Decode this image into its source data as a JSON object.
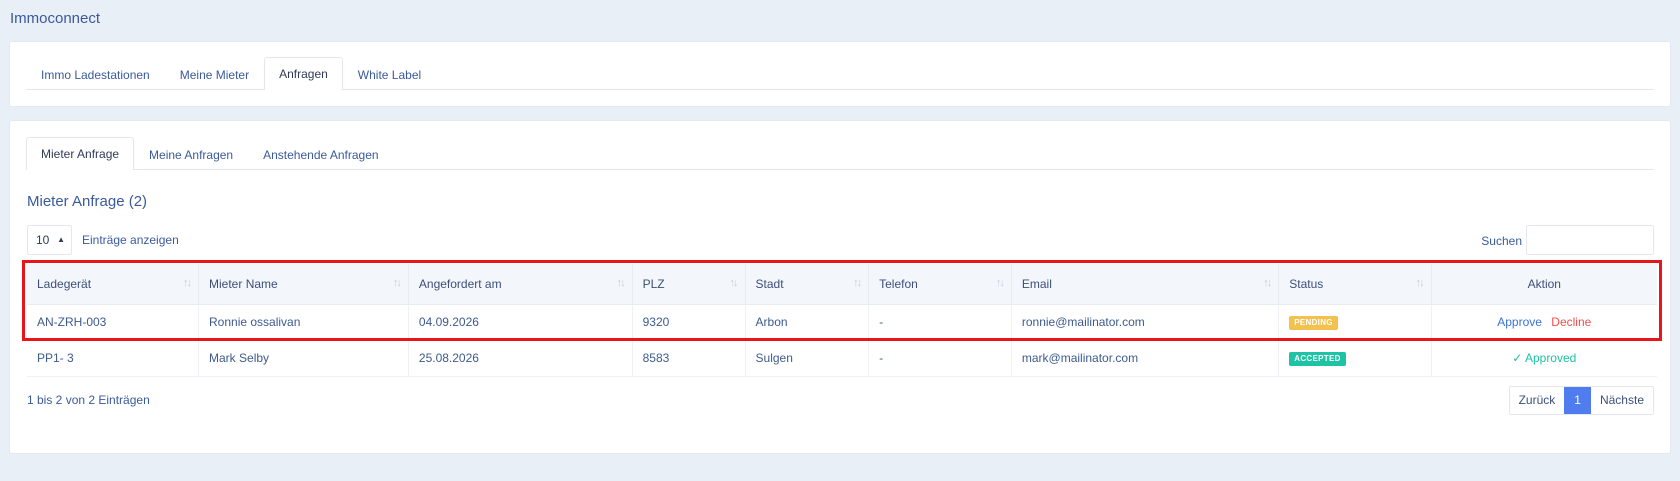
{
  "app": {
    "title": "Immoconnect"
  },
  "top_tabs": [
    {
      "label": "Immo Ladestationen",
      "active": false
    },
    {
      "label": "Meine Mieter",
      "active": false
    },
    {
      "label": "Anfragen",
      "active": true
    },
    {
      "label": "White Label",
      "active": false
    }
  ],
  "sub_tabs": [
    {
      "label": "Mieter Anfrage",
      "active": true
    },
    {
      "label": "Meine Anfragen",
      "active": false
    },
    {
      "label": "Anstehende Anfragen",
      "active": false
    }
  ],
  "section": {
    "title": "Mieter Anfrage (2)"
  },
  "controls": {
    "page_length": "10",
    "page_length_label": "Einträge anzeigen",
    "search_label": "Suchen",
    "search_value": ""
  },
  "table": {
    "columns": [
      "Ladegerät",
      "Mieter Name",
      "Angefordert am",
      "PLZ",
      "Stadt",
      "Telefon",
      "Email",
      "Status",
      "Aktion"
    ],
    "rows": [
      {
        "charger": "AN-ZRH-003",
        "name": "Ronnie ossalivan",
        "requested": "04.09.2026",
        "zip": "9320",
        "city": "Arbon",
        "phone": "-",
        "email": "ronnie@mailinator.com",
        "status": "PENDING",
        "approve_label": "Approve",
        "decline_label": "Decline"
      },
      {
        "charger": "PP1- 3",
        "name": "Mark Selby",
        "requested": "25.08.2026",
        "zip": "8583",
        "city": "Sulgen",
        "phone": "-",
        "email": "mark@mailinator.com",
        "status": "ACCEPTED",
        "approved_label": "✓ Approved"
      }
    ]
  },
  "footer": {
    "info": "1 bis 2 von 2 Einträgen",
    "prev": "Zurück",
    "current_page": "1",
    "next": "Nächste"
  },
  "colors": {
    "accent": "#4f7df0",
    "pending": "#f2c14e",
    "accepted": "#1ec2a5",
    "decline": "#f24d4d",
    "highlight": "#e8161b"
  }
}
